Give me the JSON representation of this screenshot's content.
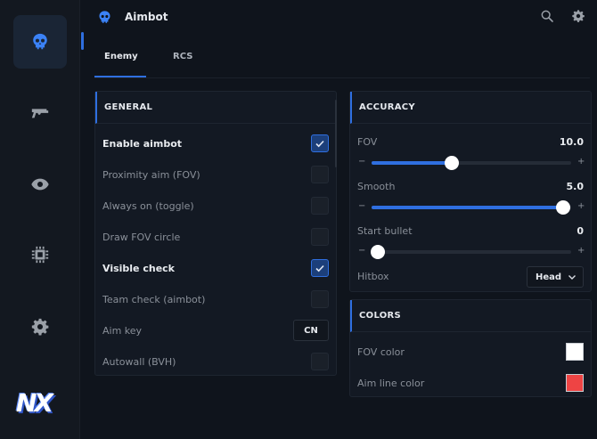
{
  "header": {
    "title": "Aimbot"
  },
  "sidebar": {
    "items": [
      {
        "name": "aimbot",
        "icon": "skull-icon",
        "active": true
      },
      {
        "name": "weapons",
        "icon": "gun-icon",
        "active": false
      },
      {
        "name": "visuals",
        "icon": "eye-icon",
        "active": false
      },
      {
        "name": "misc",
        "icon": "chip-icon",
        "active": false
      },
      {
        "name": "settings",
        "icon": "gear-icon",
        "active": false
      }
    ],
    "logo": "NX"
  },
  "tabs": [
    {
      "label": "Enemy",
      "active": true
    },
    {
      "label": "RCS",
      "active": false
    }
  ],
  "general": {
    "title": "GENERAL",
    "rows": [
      {
        "label": "Enable aimbot",
        "checked": true
      },
      {
        "label": "Proximity aim (FOV)",
        "checked": false
      },
      {
        "label": "Always on (toggle)",
        "checked": false
      },
      {
        "label": "Draw FOV circle",
        "checked": false
      },
      {
        "label": "Visible check",
        "checked": true
      },
      {
        "label": "Team check (aimbot)",
        "checked": false
      },
      {
        "label": "Aim key",
        "key": "CN"
      },
      {
        "label": "Autowall (BVH)",
        "checked": false
      }
    ]
  },
  "accuracy": {
    "title": "ACCURACY",
    "sliders": [
      {
        "label": "FOV",
        "value": "10.0",
        "fraction": 0.4
      },
      {
        "label": "Smooth",
        "value": "5.0",
        "fraction": 0.96
      },
      {
        "label": "Start bullet",
        "value": "0",
        "fraction": 0.03
      }
    ],
    "hitbox": {
      "label": "Hitbox",
      "value": "Head"
    }
  },
  "colors": {
    "title": "COLORS",
    "items": [
      {
        "label": "FOV color",
        "color": "#ffffff"
      },
      {
        "label": "Aim line color",
        "color": "#ee4444"
      }
    ]
  },
  "theme": {
    "accent": "#2f6fe0",
    "checkbox_fill": "#1c3f7a"
  }
}
